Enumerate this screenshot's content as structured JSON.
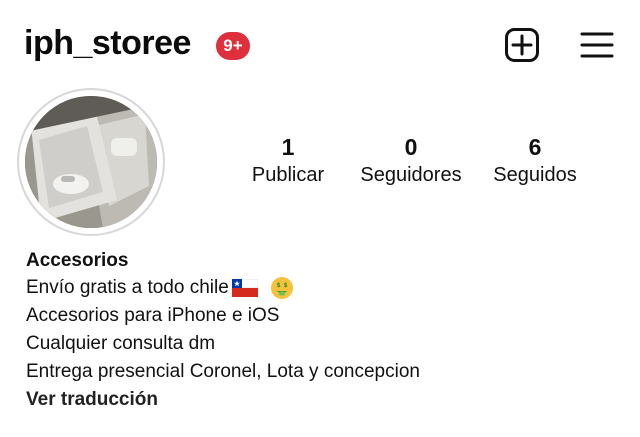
{
  "profile": {
    "username": "iph_storee",
    "notification_badge": "9+",
    "badge_color": "#e02f3c"
  },
  "stats": {
    "posts": {
      "value": "1",
      "label": "Publicar"
    },
    "followers": {
      "value": "0",
      "label": "Seguidores"
    },
    "following": {
      "value": "6",
      "label": "Seguidos"
    }
  },
  "bio": {
    "name": "Accesorios",
    "line1": "Envío gratis a todo chile",
    "line2": "Accesorios para iPhone e iOS",
    "line3": "Cualquier consulta dm",
    "line4": "Entrega presencial Coronel, Lota y concepcion",
    "translate": "Ver traducción"
  },
  "icons": {
    "add": "add-post-icon",
    "menu": "hamburger-menu-icon",
    "flag": "chile-flag-icon",
    "emoji": "money-mouth-face-icon"
  }
}
